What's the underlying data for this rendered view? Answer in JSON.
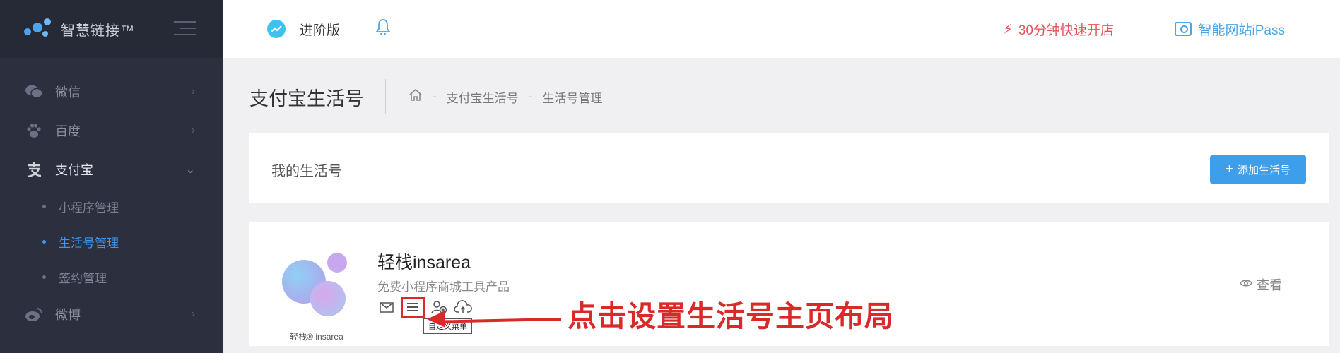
{
  "brand": {
    "name": "智慧链接™"
  },
  "sidebar": {
    "items": [
      {
        "label": "微信",
        "icon": "wechat-icon"
      },
      {
        "label": "百度",
        "icon": "paw-icon"
      },
      {
        "label": "支付宝",
        "icon": "alipay-icon",
        "sub": [
          {
            "label": "小程序管理"
          },
          {
            "label": "生活号管理"
          },
          {
            "label": "签约管理"
          }
        ]
      },
      {
        "label": "微博",
        "icon": "weibo-icon"
      }
    ]
  },
  "topbar": {
    "edition": "进阶版",
    "quick_open": "30分钟快速开店",
    "ipass": "智能网站iPass"
  },
  "page": {
    "title": "支付宝生活号",
    "breadcrumb": [
      "支付宝生活号",
      "生活号管理"
    ]
  },
  "my_section": {
    "label": "我的生活号",
    "add_button": "添加生活号"
  },
  "account": {
    "name": "轻栈insarea",
    "desc": "免费小程序商城工具产品",
    "logo_text": "轻栈® insarea",
    "tooltip": "自定义菜单",
    "view": "查看"
  },
  "annotation": "点击设置生活号主页布局",
  "colors": {
    "accent": "#3d9eec",
    "sidebar": "#2b2f3e",
    "annotation": "#d92a2a"
  }
}
